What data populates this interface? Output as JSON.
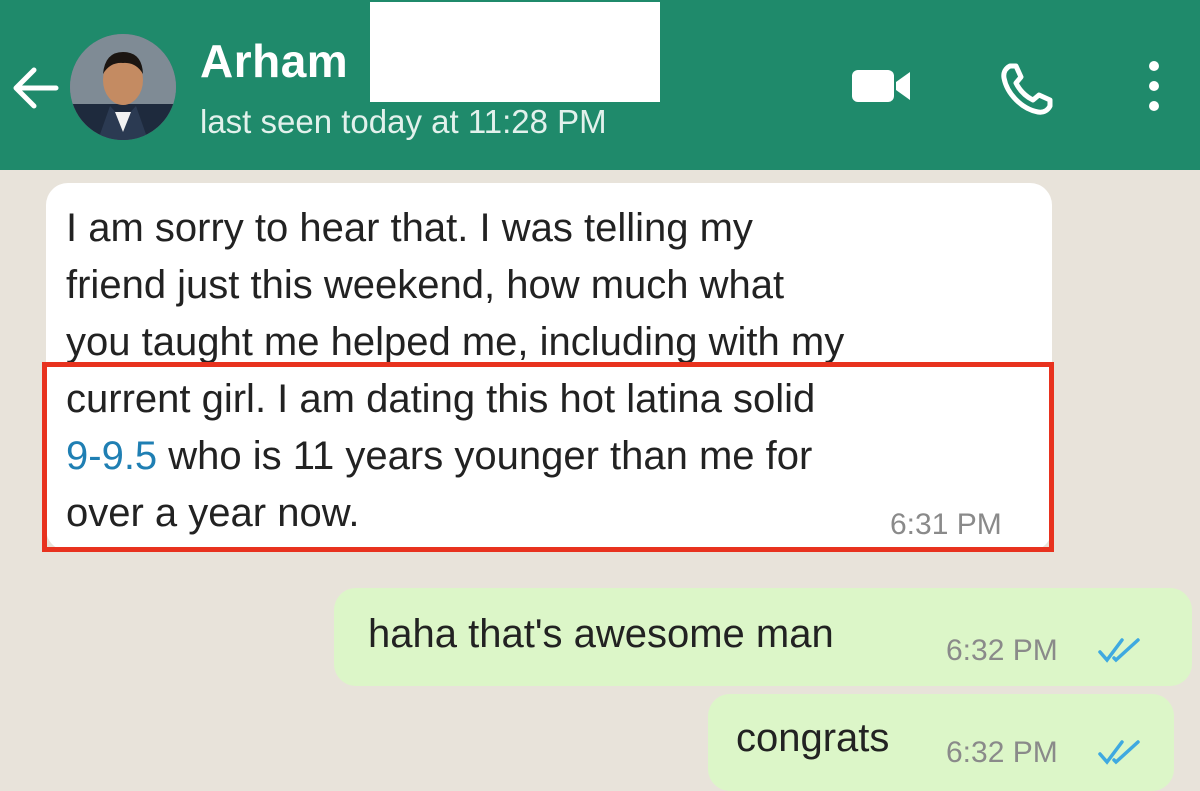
{
  "header": {
    "contact_name": "Arham",
    "last_seen": "last seen today at 11:28 PM",
    "accent_color": "#1f8a6b",
    "icons": [
      "back-arrow-icon",
      "video-call-icon",
      "voice-call-icon",
      "more-options-icon"
    ]
  },
  "messages": [
    {
      "direction": "incoming",
      "text_lines": [
        "I am sorry to hear that. I was telling my",
        "friend just this weekend, how much what",
        "you taught me helped me, including with my",
        "current girl. I am dating this hot  latina solid"
      ],
      "link_text": "9-9.5",
      "line5_rest": " who is 11 years younger than me for",
      "line6": "over a year now.",
      "time": "6:31 PM",
      "highlight_color": "#e8321e"
    },
    {
      "direction": "outgoing",
      "text": "haha that's awesome man",
      "time": "6:32 PM",
      "status": "read"
    },
    {
      "direction": "outgoing",
      "text": "congrats",
      "time": "6:32 PM",
      "status": "read"
    }
  ],
  "colors": {
    "incoming_bubble": "#ffffff",
    "outgoing_bubble": "#dcf6c8",
    "read_ticks": "#3fa9e0"
  }
}
